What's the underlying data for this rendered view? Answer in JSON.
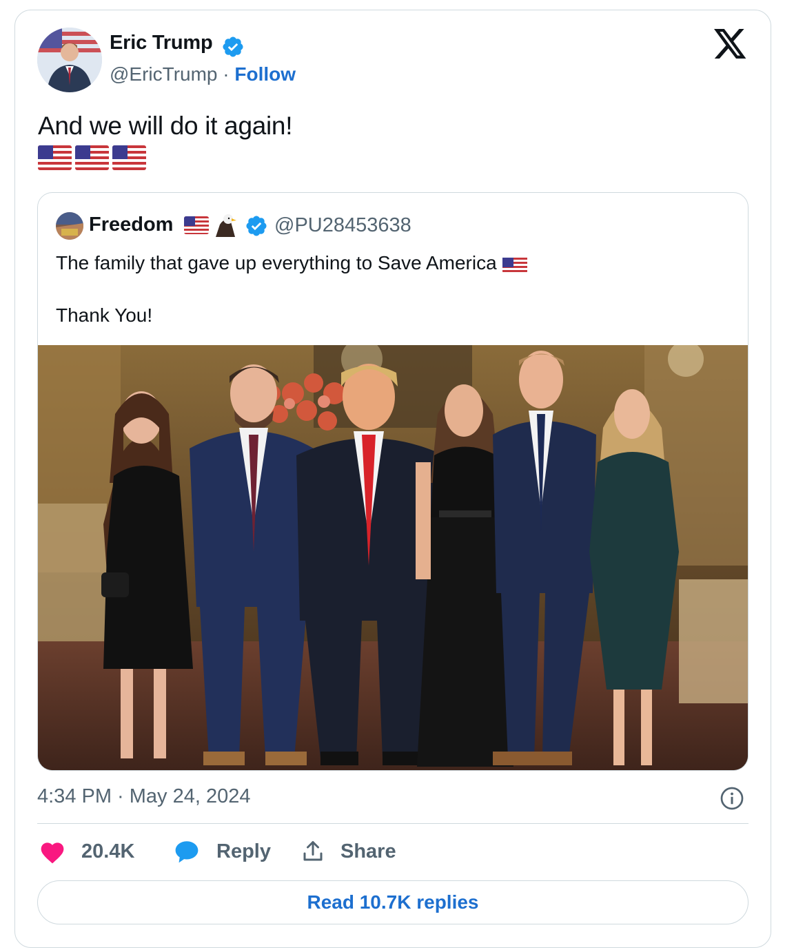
{
  "author": {
    "name": "Eric Trump",
    "handle": "@EricTrump",
    "separator": "·",
    "follow_label": "Follow",
    "avatar_icon": "profile-photo",
    "verified_icon": "verified-badge-icon"
  },
  "tweet": {
    "text": "And we will do it again!",
    "emoji": [
      "🇺🇸",
      "🇺🇸",
      "🇺🇸"
    ]
  },
  "quoted_tweet": {
    "name": "Freedom",
    "name_emoji": [
      "🇺🇸",
      "🦅"
    ],
    "handle": "@PU28453638",
    "text_line1": "The family that gave up everything to Save America",
    "text_line1_emoji": "🇺🇸",
    "text_line2": "Thank You!",
    "photo_icon": "group-photo"
  },
  "meta": {
    "timestamp": "4:34 PM · May 24, 2024"
  },
  "actions": {
    "like_count": "20.4K",
    "reply_label": "Reply",
    "share_label": "Share"
  },
  "read_replies_label": "Read 10.7K replies",
  "colors": {
    "accent": "#1d6fcf",
    "verified": "#1d9bf0",
    "like": "#f91880",
    "muted": "#536471",
    "border": "#cfd9de"
  }
}
